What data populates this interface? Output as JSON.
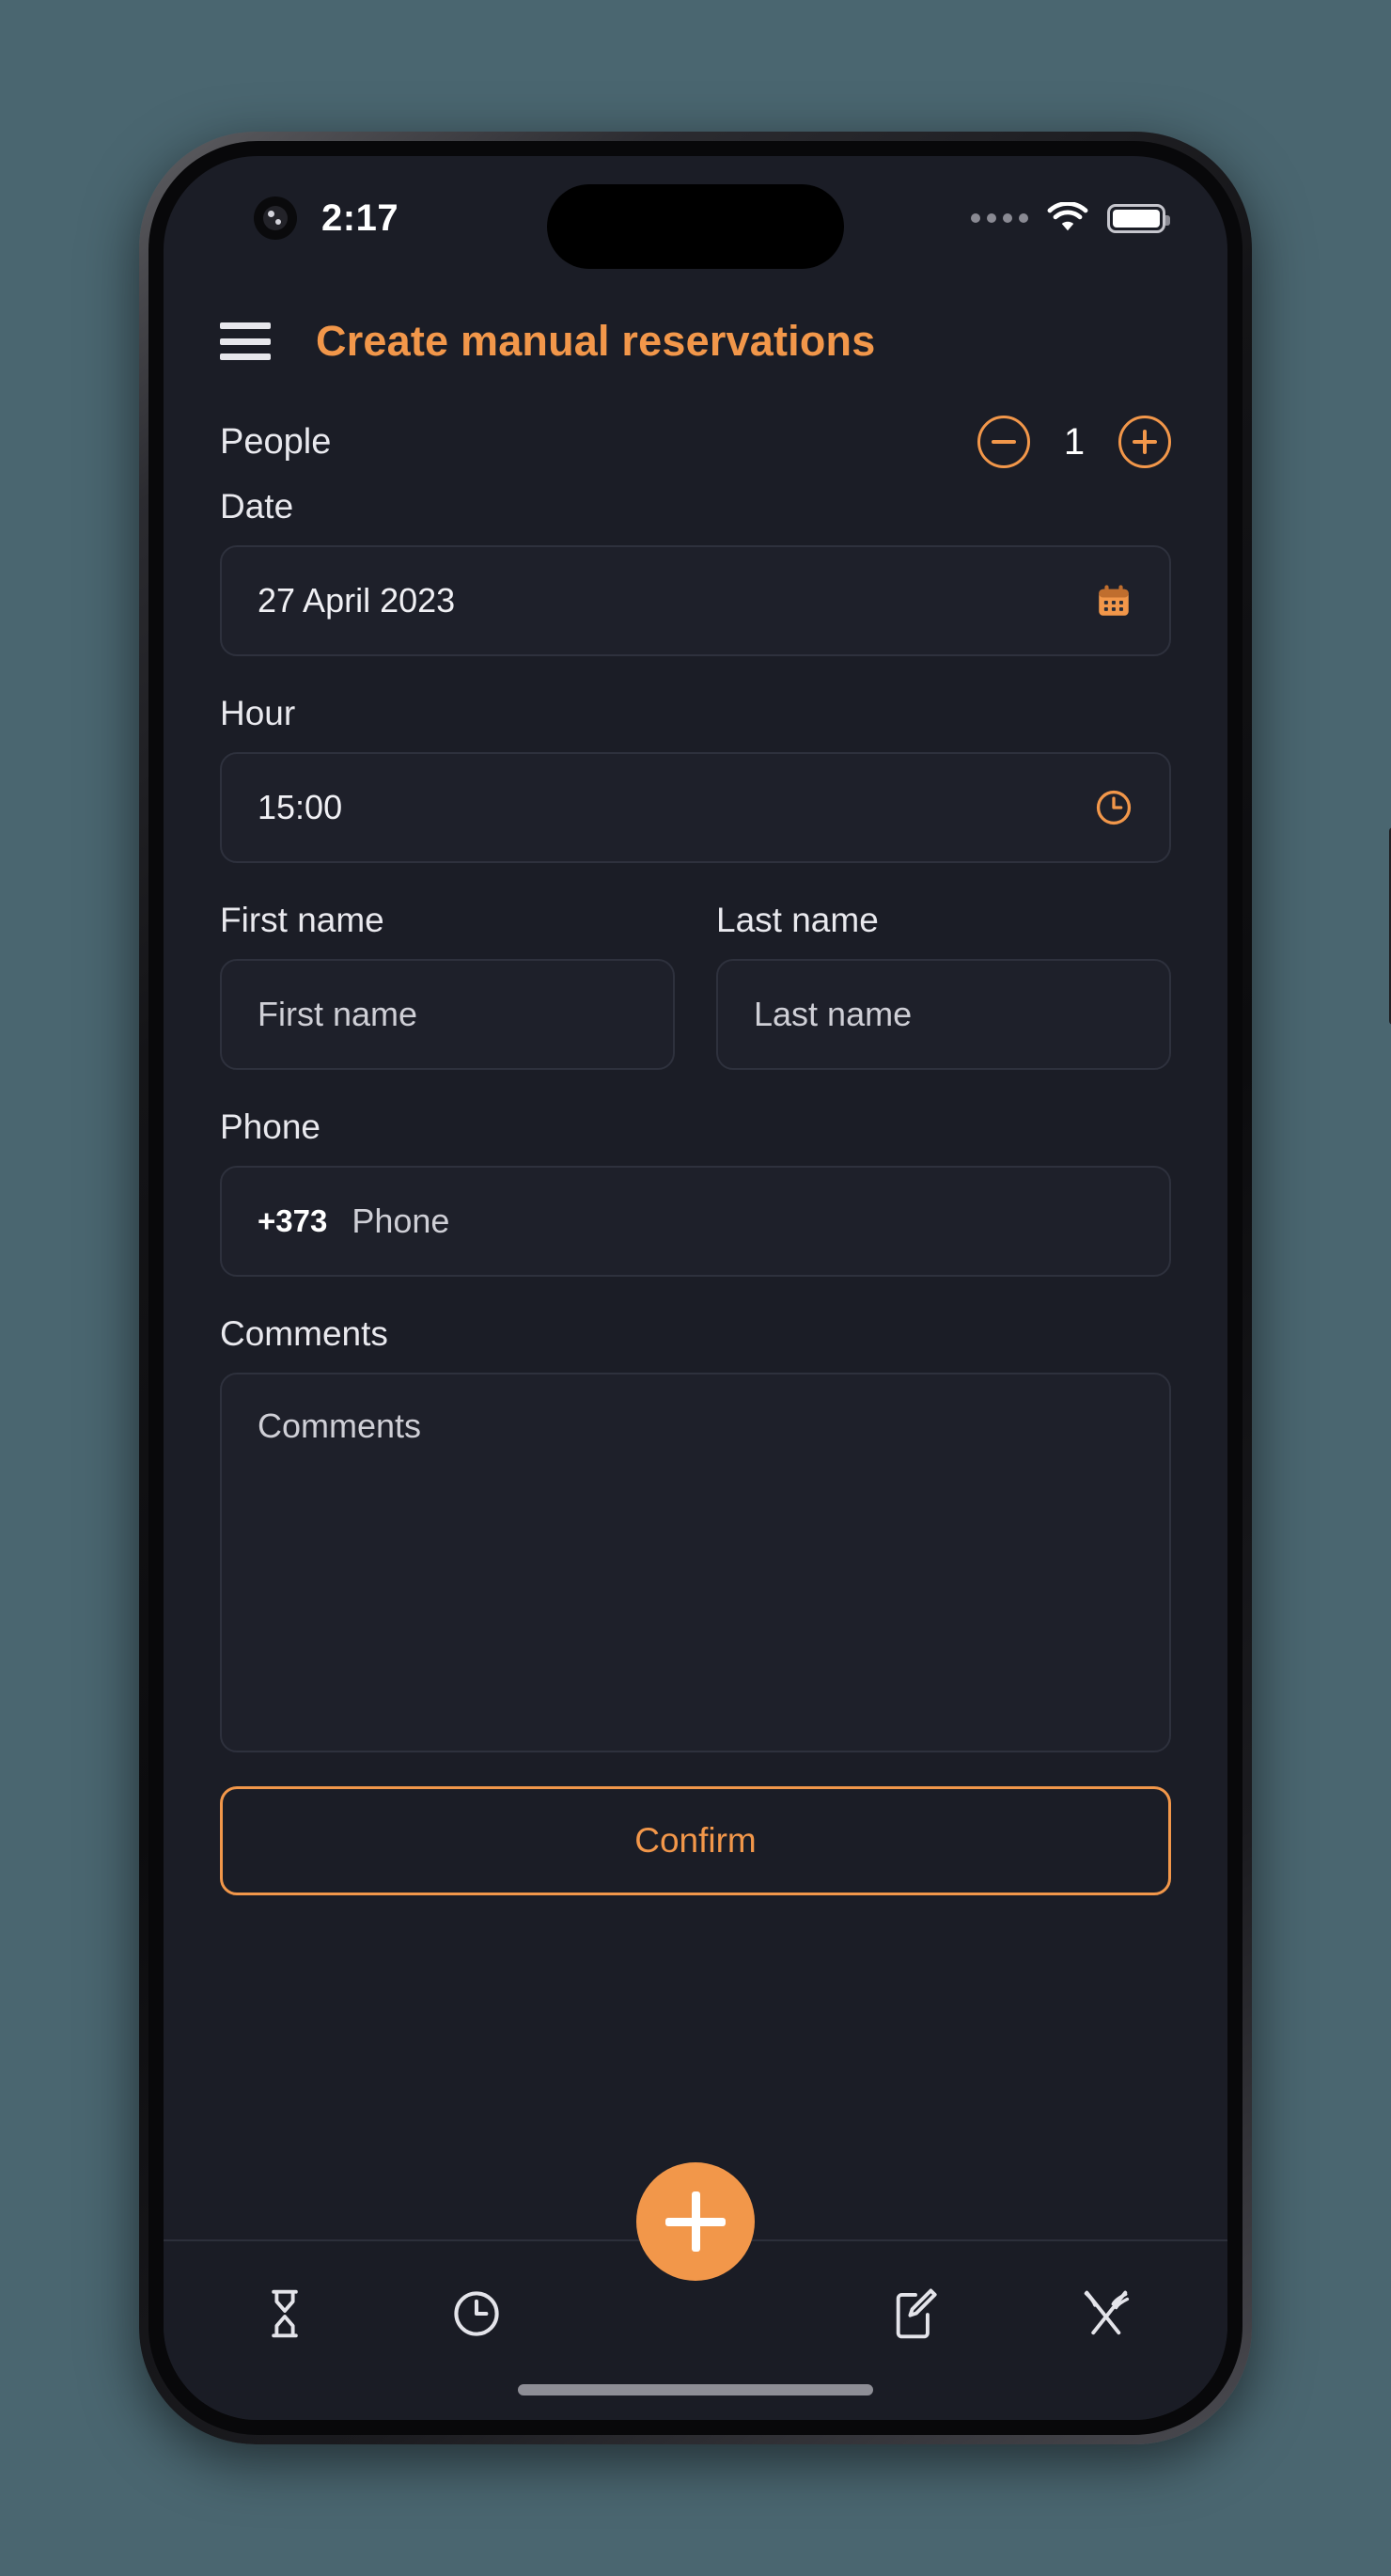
{
  "status_bar": {
    "time": "2:17",
    "signal_icon": "signal-dots-icon",
    "wifi_icon": "wifi-icon",
    "battery_icon": "battery-full-icon"
  },
  "header": {
    "menu_icon": "hamburger-menu-icon",
    "title": "Create manual reservations",
    "accent_color": "#f2974a"
  },
  "form": {
    "people": {
      "label": "People",
      "count": "1",
      "decrement_icon": "minus-circle-icon",
      "increment_icon": "plus-circle-icon"
    },
    "date": {
      "label": "Date",
      "value": "27 April 2023",
      "icon": "calendar-icon"
    },
    "hour": {
      "label": "Hour",
      "value": "15:00",
      "icon": "clock-icon"
    },
    "first_name": {
      "label": "First name",
      "placeholder": "First name",
      "value": ""
    },
    "last_name": {
      "label": "Last name",
      "placeholder": "Last name",
      "value": ""
    },
    "phone": {
      "label": "Phone",
      "country_code": "+373",
      "placeholder": "Phone",
      "value": ""
    },
    "comments": {
      "label": "Comments",
      "placeholder": "Comments",
      "value": ""
    },
    "confirm_button": {
      "label": "Confirm"
    }
  },
  "fab": {
    "icon": "plus-icon"
  },
  "bottom_nav": {
    "items": [
      {
        "icon": "hourglass-icon"
      },
      {
        "icon": "clock-icon"
      },
      {
        "icon": "compose-edit-icon"
      },
      {
        "icon": "cutlery-icon"
      }
    ]
  },
  "colors": {
    "accent": "#f2974a",
    "screen_bg": "#1b1d26",
    "field_bg": "#1e202a",
    "field_border": "#2e313d"
  }
}
